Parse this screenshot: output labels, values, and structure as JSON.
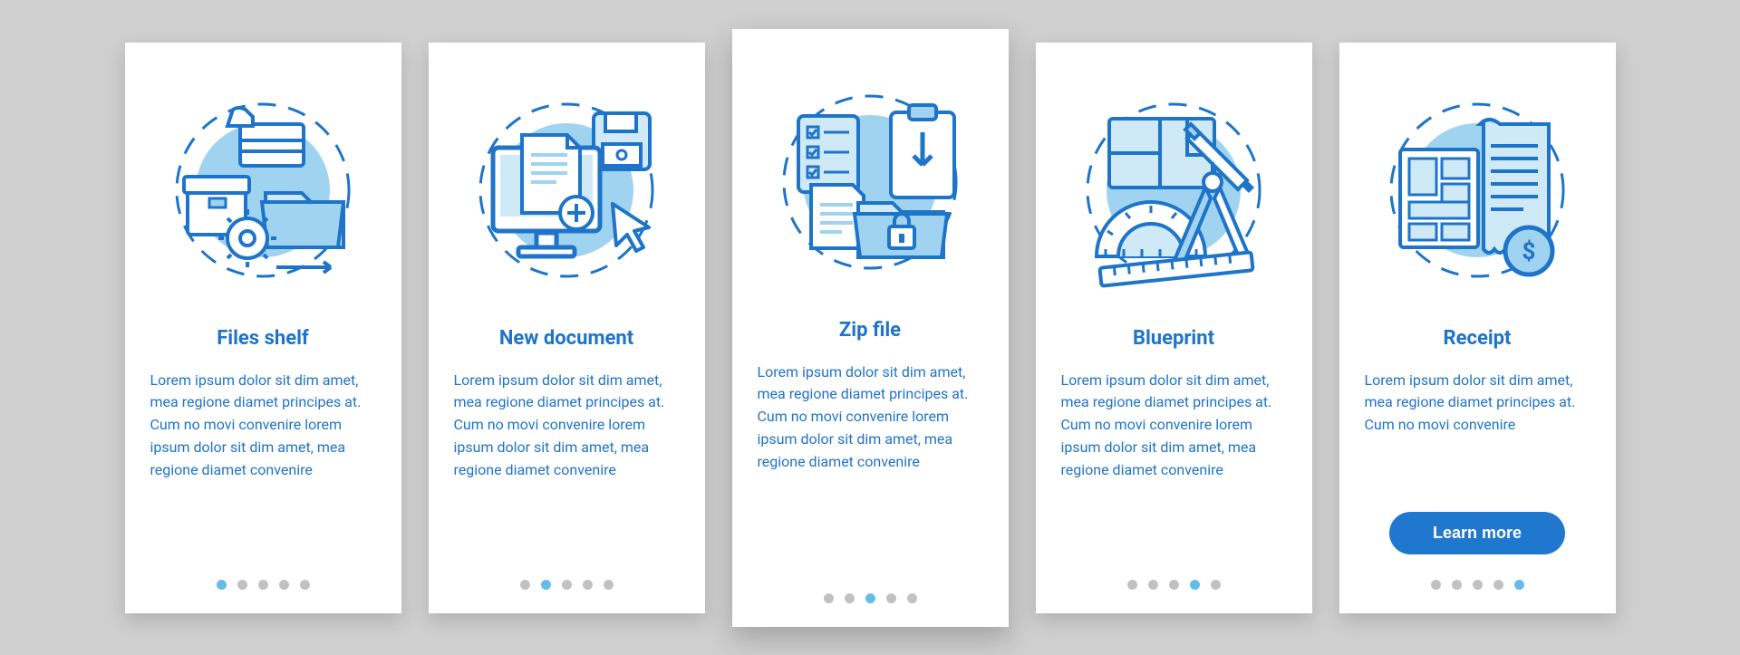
{
  "colors": {
    "accent": "#1e74c8",
    "accent_fill": "#1f78cd",
    "icon_light": "#9fd3f0",
    "icon_bg": "#cfe9f7"
  },
  "lorem_long": "Lorem ipsum dolor sit dim amet, mea regione diamet principes at. Cum no movi convenire lorem ipsum dolor sit dim amet, mea regione diamet convenire",
  "lorem_short": "Lorem ipsum dolor sit dim amet, mea regione diamet principes at. Cum no movi convenire",
  "cards": [
    {
      "title": "Files shelf",
      "active_index": 0,
      "icon": "files-shelf-icon"
    },
    {
      "title": "New document",
      "active_index": 1,
      "icon": "new-document-icon"
    },
    {
      "title": "Zip file",
      "active_index": 2,
      "icon": "zip-file-icon",
      "featured": true
    },
    {
      "title": "Blueprint",
      "active_index": 3,
      "icon": "blueprint-icon"
    },
    {
      "title": "Receipt",
      "active_index": 4,
      "icon": "receipt-icon",
      "button": "Learn more"
    }
  ]
}
